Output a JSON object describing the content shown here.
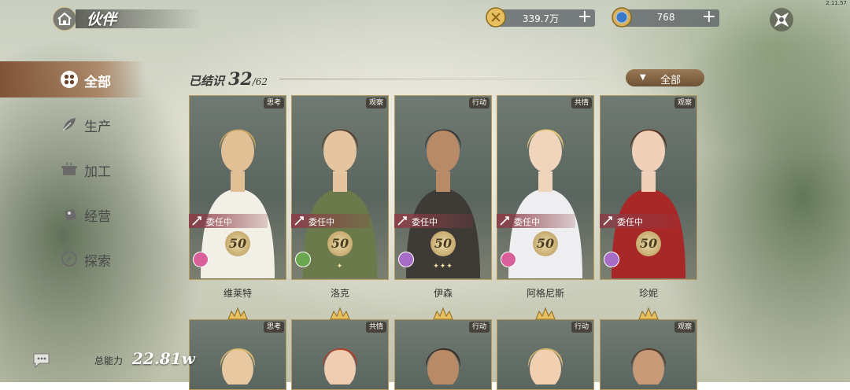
{
  "header": {
    "title": "伙伴",
    "version": "2.11.57",
    "currency_gold": "339.7万",
    "currency_gem": "768",
    "plus": "+"
  },
  "sidebar": {
    "items": [
      {
        "label": "全部",
        "icon": "grid-icon",
        "active": true
      },
      {
        "label": "生产",
        "icon": "leaf-icon",
        "active": false
      },
      {
        "label": "加工",
        "icon": "pot-icon",
        "active": false
      },
      {
        "label": "经营",
        "icon": "bag-icon",
        "active": false
      },
      {
        "label": "探索",
        "icon": "compass-icon",
        "active": false
      }
    ]
  },
  "summary": {
    "label": "已结识",
    "count": "32",
    "total": "/62",
    "filter_label": "全部"
  },
  "cards": [
    {
      "name": "维莱特",
      "tag": "思考",
      "status": "委任中",
      "level": "50",
      "stars": "",
      "talent_color": "#d9609a",
      "skin": "#e2c096",
      "hair": "#c9a45a",
      "cloth": "#f2efe6"
    },
    {
      "name": "洛克",
      "tag": "观察",
      "status": "委任中",
      "level": "50",
      "stars": "✦",
      "talent_color": "#6aa84f",
      "skin": "#e5c4a0",
      "hair": "#5a4030",
      "cloth": "#6b7a4a"
    },
    {
      "name": "伊森",
      "tag": "行动",
      "status": "委任中",
      "level": "50",
      "stars": "✦✦✦",
      "talent_color": "#a66cc6",
      "skin": "#b88a66",
      "hair": "#3a3a38",
      "cloth": "#3e3a36"
    },
    {
      "name": "阿格尼斯",
      "tag": "共情",
      "status": "委任中",
      "level": "50",
      "stars": "",
      "talent_color": "#d9609a",
      "skin": "#f0d4bc",
      "hair": "#e8c878",
      "cloth": "#eeeef0"
    },
    {
      "name": "珍妮",
      "tag": "观察",
      "status": "委任中",
      "level": "50",
      "stars": "",
      "talent_color": "#a66cc6",
      "skin": "#f0d0b8",
      "hair": "#5a3020",
      "cloth": "#a82828"
    }
  ],
  "row2": [
    {
      "tag": "思考",
      "skin": "#e8c8a0",
      "hair": "#d8b870"
    },
    {
      "tag": "共情",
      "skin": "#f0ccb0",
      "hair": "#b04028"
    },
    {
      "tag": "行动",
      "skin": "#b88a66",
      "hair": "#3a2e26"
    },
    {
      "tag": "行动",
      "skin": "#f0d0b0",
      "hair": "#d8b870"
    },
    {
      "tag": "观察",
      "skin": "#c89a78",
      "hair": "#5a3a28"
    }
  ],
  "footer": {
    "power_label": "总能力",
    "power_value": "22.81w"
  },
  "colors": {
    "accent_gold": "#b89a5c",
    "active_tab": "#8a5030",
    "status_bg": "#8c3c46"
  }
}
